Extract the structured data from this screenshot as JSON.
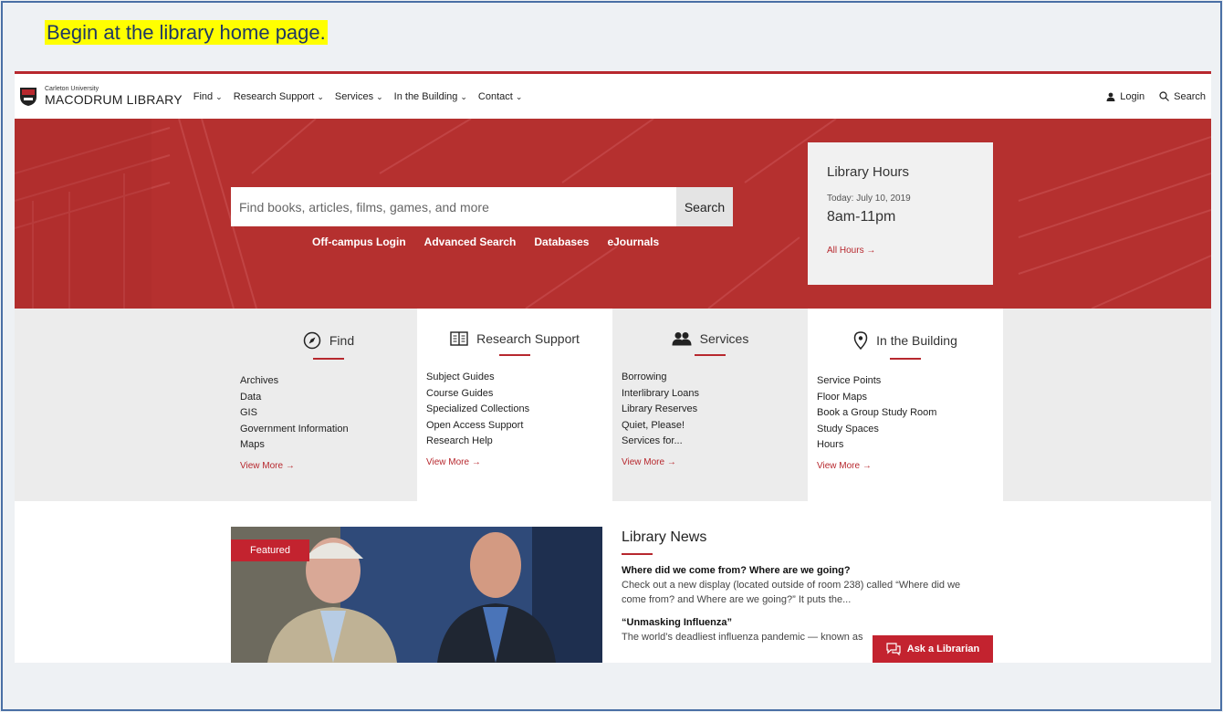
{
  "instruction": "Begin at the library home page.",
  "header": {
    "logo_small": "Carleton University",
    "logo_big": "MACODRUM LIBRARY",
    "menu": [
      {
        "label": "Find"
      },
      {
        "label": "Research Support"
      },
      {
        "label": "Services"
      },
      {
        "label": "In the Building"
      },
      {
        "label": "Contact"
      }
    ],
    "login_label": "Login",
    "search_label": "Search"
  },
  "hero": {
    "search_placeholder": "Find books, articles, films, games, and more",
    "search_button": "Search",
    "quick_links": [
      "Off-campus Login",
      "Advanced Search",
      "Databases",
      "eJournals"
    ]
  },
  "hours": {
    "title": "Library Hours",
    "date": "Today: July 10, 2019",
    "time": "8am-11pm",
    "link": "All Hours →"
  },
  "categories": [
    {
      "title": "Find",
      "icon": "compass-icon",
      "items": [
        "Archives",
        "Data",
        "GIS",
        "Government Information",
        "Maps"
      ],
      "more": "View More →"
    },
    {
      "title": "Research Support",
      "icon": "book-open-icon",
      "items": [
        "Subject Guides",
        "Course Guides",
        "Specialized Collections",
        "Open Access Support",
        "Research Help"
      ],
      "more": "View More →"
    },
    {
      "title": "Services",
      "icon": "users-icon",
      "items": [
        "Borrowing",
        "Interlibrary Loans",
        "Library Reserves",
        "Quiet, Please!",
        "Services for..."
      ],
      "more": "View More →"
    },
    {
      "title": "In the Building",
      "icon": "map-pin-icon",
      "items": [
        "Service Points",
        "Floor Maps",
        "Book a Group Study Room",
        "Study Spaces",
        "Hours"
      ],
      "more": "View More →"
    }
  ],
  "featured": {
    "badge": "Featured"
  },
  "news": {
    "title": "Library News",
    "items": [
      {
        "title": "Where did we come from? Where are we going?",
        "body": "Check out a new display (located outside of room 238) called “Where did we come from? and Where are we going?” It puts the..."
      },
      {
        "title": "“Unmasking Influenza”",
        "body": "The world’s deadliest influenza pandemic — known as"
      }
    ]
  },
  "ask": {
    "label": "Ask a Librarian"
  },
  "colors": {
    "brand_red": "#b7282e",
    "hero_red": "#b5302f",
    "highlight": "#ffff00",
    "frame_border": "#4a6fa5"
  }
}
